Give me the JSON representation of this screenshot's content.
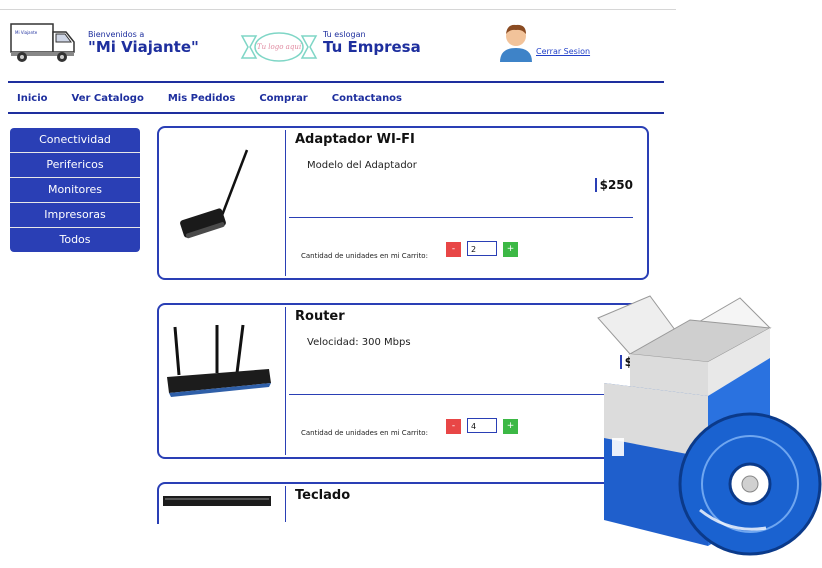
{
  "header": {
    "truck_text": "Mi Viajante",
    "welcome_small": "Bienvenidos a",
    "welcome_big": "\"Mi Viajante\"",
    "logo_text": "Tu logo aquí",
    "slogan_small": "Tu eslogan",
    "slogan_big": "Tu Empresa",
    "logout_label": "Cerrar Sesion"
  },
  "nav": {
    "items": [
      {
        "label": "Inicio"
      },
      {
        "label": "Ver Catalogo"
      },
      {
        "label": "Mis Pedidos"
      },
      {
        "label": "Comprar"
      },
      {
        "label": "Contactanos"
      }
    ]
  },
  "sidebar": {
    "items": [
      {
        "label": "Conectividad"
      },
      {
        "label": "Perifericos"
      },
      {
        "label": "Monitores"
      },
      {
        "label": "Impresoras"
      },
      {
        "label": "Todos"
      }
    ]
  },
  "products": [
    {
      "title": "Adaptador WI-FI",
      "description": "Modelo del Adaptador",
      "price": "$250",
      "qty_label": "Cantidad de unidades en mi Carrito:",
      "qty": "2",
      "minus": "-",
      "plus": "+"
    },
    {
      "title": "Router",
      "description": "Velocidad: 300 Mbps",
      "price": "$",
      "qty_label": "Cantidad de unidades en mi Carrito:",
      "qty": "4",
      "minus": "-",
      "plus": "+"
    },
    {
      "title": "Teclado"
    }
  ],
  "colors": {
    "primary": "#2a3fb5",
    "minus": "#e84646",
    "plus": "#3cb845"
  }
}
